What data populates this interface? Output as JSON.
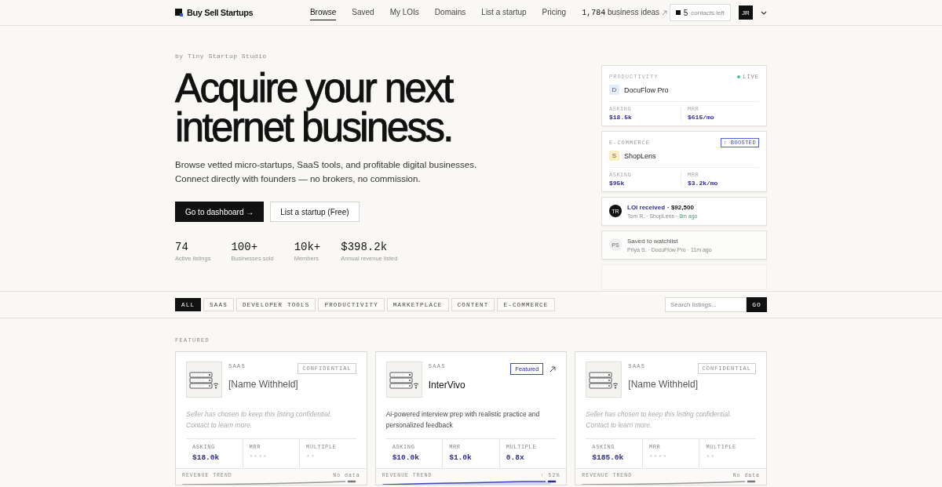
{
  "header": {
    "logo": "Buy Sell Startups",
    "nav": [
      {
        "label": "Browse",
        "selected": true
      },
      {
        "label": "Saved",
        "selected": false
      },
      {
        "label": "My LOIs",
        "selected": false
      },
      {
        "label": "Domains",
        "selected": false
      },
      {
        "label": "List a startup",
        "selected": false
      },
      {
        "label": "Pricing",
        "selected": false
      }
    ],
    "ideas": {
      "count": "1,784",
      "label": "business ideas"
    },
    "contacts": {
      "count": "5",
      "label": "contacts left"
    },
    "avatar": "JR"
  },
  "hero": {
    "byline": "by Tiny Startup Studio",
    "title": "Acquire your next internet business.",
    "subtitle": "Browse vetted micro-startups, SaaS tools, and profitable digital businesses. Connect directly with founders — no brokers, no commission.",
    "buttons": [
      {
        "label": "Go to dashboard →",
        "kind": "primary"
      },
      {
        "label": "List a startup (Free)",
        "kind": "secondary"
      }
    ],
    "stats": [
      {
        "value": "74",
        "label": "Active listings"
      },
      {
        "value": "100+",
        "label": "Businesses sold"
      },
      {
        "value": "10k+",
        "label": "Members"
      },
      {
        "value": "$398.2k",
        "label": "Annual revenue listed"
      }
    ]
  },
  "feed": [
    {
      "kind": "listing",
      "category": "PRODUCTIVITY",
      "status": "LIVE",
      "initial": "D",
      "color": "#e4ecfb",
      "name": "DocuFlow Pro",
      "metrics": [
        {
          "label": "ASKING",
          "value": "$18.5k"
        },
        {
          "label": "MRR",
          "value": "$615/mo"
        }
      ]
    },
    {
      "kind": "listing",
      "category": "E-COMMERCE",
      "badge": "↑ BOOSTED",
      "initial": "S",
      "color": "#fbefc2",
      "name": "ShopLens",
      "metrics": [
        {
          "label": "ASKING",
          "value": "$95k"
        },
        {
          "label": "MRR",
          "value": "$3.2k/mo"
        }
      ]
    },
    {
      "kind": "activity",
      "avatar": "TR",
      "color": "#111111",
      "title": "LOI received",
      "amount": "· $92,500",
      "meta": "Tom R. · ShopLens ·",
      "time": "8m ago",
      "faded": false
    },
    {
      "kind": "activity",
      "avatar": "PS",
      "color": "#eeeeee",
      "title": "Saved to watchlist",
      "meta": "Priya S. · DocuFlow Pro · 11m ago",
      "faded": true
    },
    {
      "kind": "blank"
    }
  ],
  "filters": {
    "chips": [
      {
        "label": "ALL",
        "selected": true
      },
      {
        "label": "SAAS",
        "selected": false
      },
      {
        "label": "DEVELOPER TOOLS",
        "selected": false
      },
      {
        "label": "PRODUCTIVITY",
        "selected": false
      },
      {
        "label": "MARKETPLACE",
        "selected": false
      },
      {
        "label": "CONTENT",
        "selected": false
      },
      {
        "label": "E-COMMERCE",
        "selected": false
      }
    ],
    "search": {
      "placeholder": "Search listings...",
      "button": "GO"
    }
  },
  "featured": {
    "heading": "FEATURED",
    "listings": [
      {
        "category": "SAAS",
        "name": "[Name Withheld]",
        "confidential": true,
        "badge": "CONFIDENTIAL",
        "description": "Seller has chosen to keep this listing confidential. Contact to learn more.",
        "metrics": [
          {
            "label": "ASKING",
            "value": "$18.0k"
          },
          {
            "label": "MRR",
            "value": "****"
          },
          {
            "label": "MULTIPLE",
            "value": "**"
          }
        ],
        "trend_label": "REVENUE TREND",
        "trend": "No data",
        "growing": false
      },
      {
        "category": "SAAS",
        "name": "InterVivo",
        "confidential": false,
        "badge": "Featured",
        "description": "Ai-powered interview prep with realistic practice and personalized feedback",
        "metrics": [
          {
            "label": "ASKING",
            "value": "$10.0k"
          },
          {
            "label": "MRR",
            "value": "$1.0k"
          },
          {
            "label": "MULTIPLE",
            "value": "0.8x"
          }
        ],
        "trend_label": "REVENUE TREND",
        "trend": "↑ 52%",
        "growing": true
      },
      {
        "category": "SAAS",
        "name": "[Name Withheld]",
        "confidential": true,
        "badge": "CONFIDENTIAL",
        "description": "Seller has chosen to keep this listing confidential. Contact to learn more.",
        "metrics": [
          {
            "label": "ASKING",
            "value": "$185.0k"
          },
          {
            "label": "MRR",
            "value": "****"
          },
          {
            "label": "MULTIPLE",
            "value": "**"
          }
        ],
        "trend_label": "REVENUE TREND",
        "trend": "No data",
        "growing": false
      }
    ]
  }
}
